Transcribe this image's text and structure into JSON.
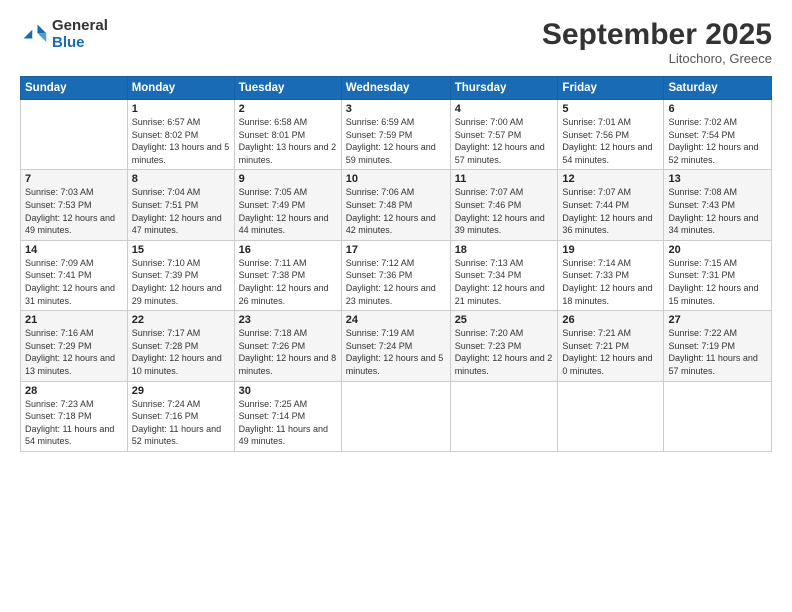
{
  "header": {
    "logo_general": "General",
    "logo_blue": "Blue",
    "month_title": "September 2025",
    "subtitle": "Litochoro, Greece"
  },
  "weekdays": [
    "Sunday",
    "Monday",
    "Tuesday",
    "Wednesday",
    "Thursday",
    "Friday",
    "Saturday"
  ],
  "weeks": [
    [
      {
        "day": "",
        "info": ""
      },
      {
        "day": "1",
        "info": "Sunrise: 6:57 AM\nSunset: 8:02 PM\nDaylight: 13 hours\nand 5 minutes."
      },
      {
        "day": "2",
        "info": "Sunrise: 6:58 AM\nSunset: 8:01 PM\nDaylight: 13 hours\nand 2 minutes."
      },
      {
        "day": "3",
        "info": "Sunrise: 6:59 AM\nSunset: 7:59 PM\nDaylight: 12 hours\nand 59 minutes."
      },
      {
        "day": "4",
        "info": "Sunrise: 7:00 AM\nSunset: 7:57 PM\nDaylight: 12 hours\nand 57 minutes."
      },
      {
        "day": "5",
        "info": "Sunrise: 7:01 AM\nSunset: 7:56 PM\nDaylight: 12 hours\nand 54 minutes."
      },
      {
        "day": "6",
        "info": "Sunrise: 7:02 AM\nSunset: 7:54 PM\nDaylight: 12 hours\nand 52 minutes."
      }
    ],
    [
      {
        "day": "7",
        "info": "Sunrise: 7:03 AM\nSunset: 7:53 PM\nDaylight: 12 hours\nand 49 minutes."
      },
      {
        "day": "8",
        "info": "Sunrise: 7:04 AM\nSunset: 7:51 PM\nDaylight: 12 hours\nand 47 minutes."
      },
      {
        "day": "9",
        "info": "Sunrise: 7:05 AM\nSunset: 7:49 PM\nDaylight: 12 hours\nand 44 minutes."
      },
      {
        "day": "10",
        "info": "Sunrise: 7:06 AM\nSunset: 7:48 PM\nDaylight: 12 hours\nand 42 minutes."
      },
      {
        "day": "11",
        "info": "Sunrise: 7:07 AM\nSunset: 7:46 PM\nDaylight: 12 hours\nand 39 minutes."
      },
      {
        "day": "12",
        "info": "Sunrise: 7:07 AM\nSunset: 7:44 PM\nDaylight: 12 hours\nand 36 minutes."
      },
      {
        "day": "13",
        "info": "Sunrise: 7:08 AM\nSunset: 7:43 PM\nDaylight: 12 hours\nand 34 minutes."
      }
    ],
    [
      {
        "day": "14",
        "info": "Sunrise: 7:09 AM\nSunset: 7:41 PM\nDaylight: 12 hours\nand 31 minutes."
      },
      {
        "day": "15",
        "info": "Sunrise: 7:10 AM\nSunset: 7:39 PM\nDaylight: 12 hours\nand 29 minutes."
      },
      {
        "day": "16",
        "info": "Sunrise: 7:11 AM\nSunset: 7:38 PM\nDaylight: 12 hours\nand 26 minutes."
      },
      {
        "day": "17",
        "info": "Sunrise: 7:12 AM\nSunset: 7:36 PM\nDaylight: 12 hours\nand 23 minutes."
      },
      {
        "day": "18",
        "info": "Sunrise: 7:13 AM\nSunset: 7:34 PM\nDaylight: 12 hours\nand 21 minutes."
      },
      {
        "day": "19",
        "info": "Sunrise: 7:14 AM\nSunset: 7:33 PM\nDaylight: 12 hours\nand 18 minutes."
      },
      {
        "day": "20",
        "info": "Sunrise: 7:15 AM\nSunset: 7:31 PM\nDaylight: 12 hours\nand 15 minutes."
      }
    ],
    [
      {
        "day": "21",
        "info": "Sunrise: 7:16 AM\nSunset: 7:29 PM\nDaylight: 12 hours\nand 13 minutes."
      },
      {
        "day": "22",
        "info": "Sunrise: 7:17 AM\nSunset: 7:28 PM\nDaylight: 12 hours\nand 10 minutes."
      },
      {
        "day": "23",
        "info": "Sunrise: 7:18 AM\nSunset: 7:26 PM\nDaylight: 12 hours\nand 8 minutes."
      },
      {
        "day": "24",
        "info": "Sunrise: 7:19 AM\nSunset: 7:24 PM\nDaylight: 12 hours\nand 5 minutes."
      },
      {
        "day": "25",
        "info": "Sunrise: 7:20 AM\nSunset: 7:23 PM\nDaylight: 12 hours\nand 2 minutes."
      },
      {
        "day": "26",
        "info": "Sunrise: 7:21 AM\nSunset: 7:21 PM\nDaylight: 12 hours\nand 0 minutes."
      },
      {
        "day": "27",
        "info": "Sunrise: 7:22 AM\nSunset: 7:19 PM\nDaylight: 11 hours\nand 57 minutes."
      }
    ],
    [
      {
        "day": "28",
        "info": "Sunrise: 7:23 AM\nSunset: 7:18 PM\nDaylight: 11 hours\nand 54 minutes."
      },
      {
        "day": "29",
        "info": "Sunrise: 7:24 AM\nSunset: 7:16 PM\nDaylight: 11 hours\nand 52 minutes."
      },
      {
        "day": "30",
        "info": "Sunrise: 7:25 AM\nSunset: 7:14 PM\nDaylight: 11 hours\nand 49 minutes."
      },
      {
        "day": "",
        "info": ""
      },
      {
        "day": "",
        "info": ""
      },
      {
        "day": "",
        "info": ""
      },
      {
        "day": "",
        "info": ""
      }
    ]
  ]
}
